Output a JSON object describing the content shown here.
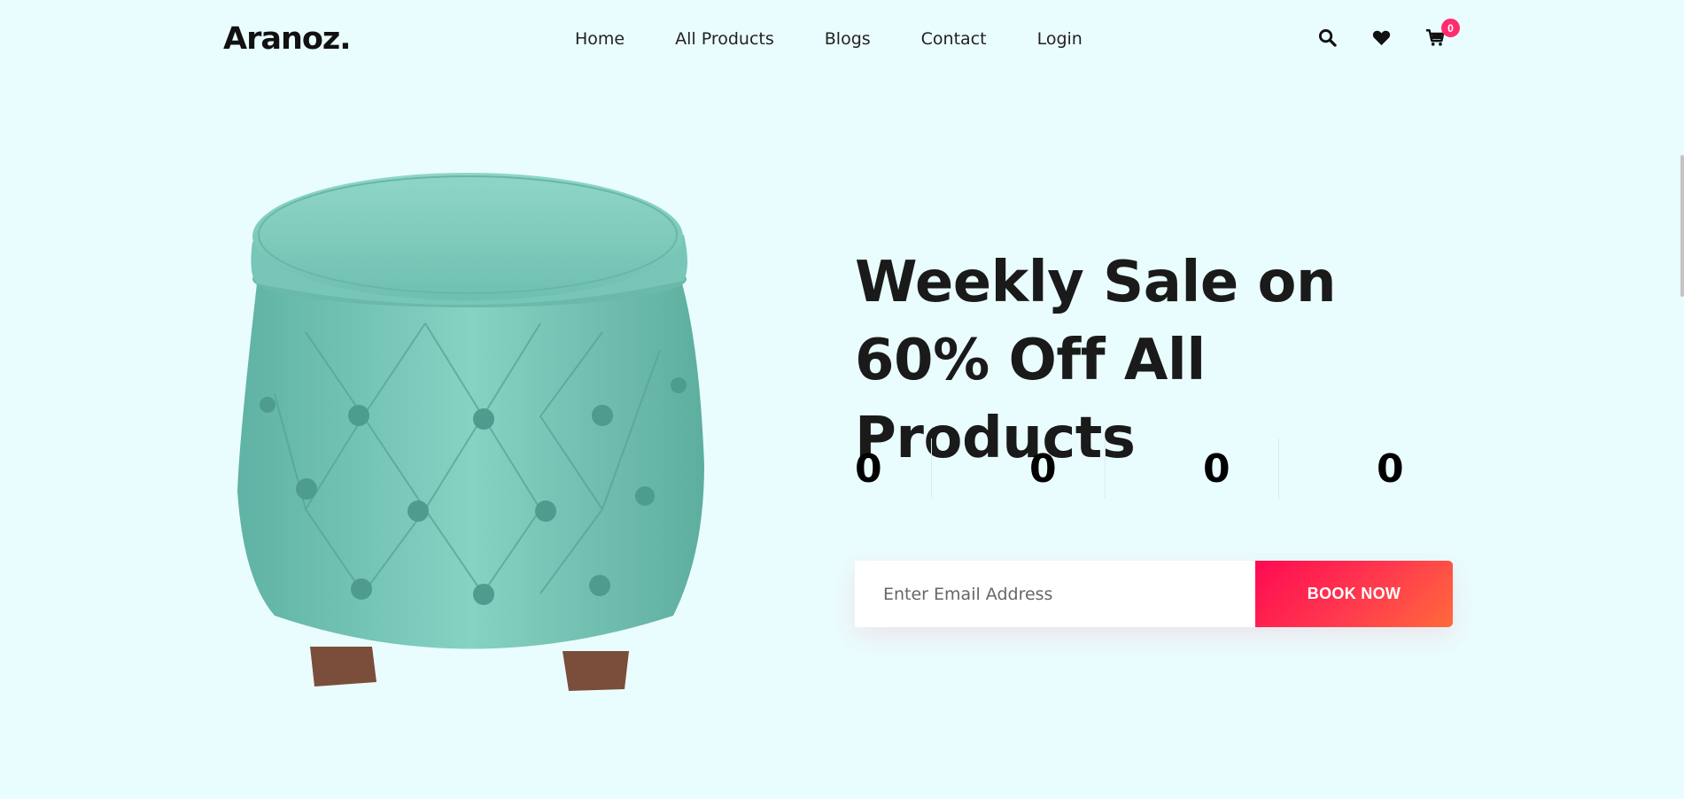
{
  "header": {
    "logo": "Aranoz.",
    "nav": [
      "Home",
      "All Products",
      "Blogs",
      "Contact",
      "Login"
    ],
    "cart_count": "0",
    "icons": [
      "search-icon",
      "heart-icon",
      "cart-icon"
    ]
  },
  "hero": {
    "title": "Weekly Sale on 60% Off All Products",
    "countdown": [
      "0",
      "0",
      "0",
      "0"
    ]
  },
  "subscribe": {
    "placeholder": "Enter Email Address",
    "button_label": "BOOK NOW"
  },
  "colors": {
    "background": "#eafdfe",
    "accent": "#ff2d6e",
    "product": "#7ec9bb"
  }
}
